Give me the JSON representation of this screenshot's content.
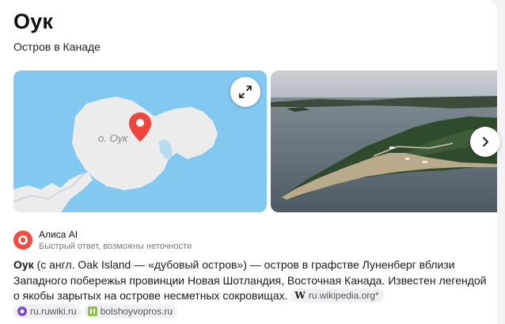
{
  "header": {
    "title": "Оук",
    "subtitle": "Остров в Канаде"
  },
  "map": {
    "island_label": "о. Оук",
    "expand_icon": "expand-arrows-icon",
    "pin_icon": "map-pin-icon",
    "colors": {
      "water": "#82c8f0",
      "land": "#ececec",
      "pin": "#f0453a"
    }
  },
  "gallery": {
    "next_icon": "chevron-right-icon"
  },
  "assistant": {
    "name": "Алиса AI",
    "note": "Быстрый ответ, возможны неточности",
    "logo_color": "#f24a3d"
  },
  "description": {
    "term": "Оук",
    "text": " (с англ. Oak Island — «дубовый остров») — остров в графстве Луненберг вблизи Западного побережья провинции Новая Шотландия, Восточная Канада. Известен легендой о якобы зарытых на острове несметных сокровищах.",
    "sources": [
      {
        "label": "ru.wikipedia.org*",
        "icon": "wikipedia-icon"
      },
      {
        "label": "ru.ruwiki.ru",
        "icon": "ruwiki-icon"
      },
      {
        "label": "bolshoyvopros.ru",
        "icon": "bolshoyvopros-icon"
      }
    ]
  }
}
